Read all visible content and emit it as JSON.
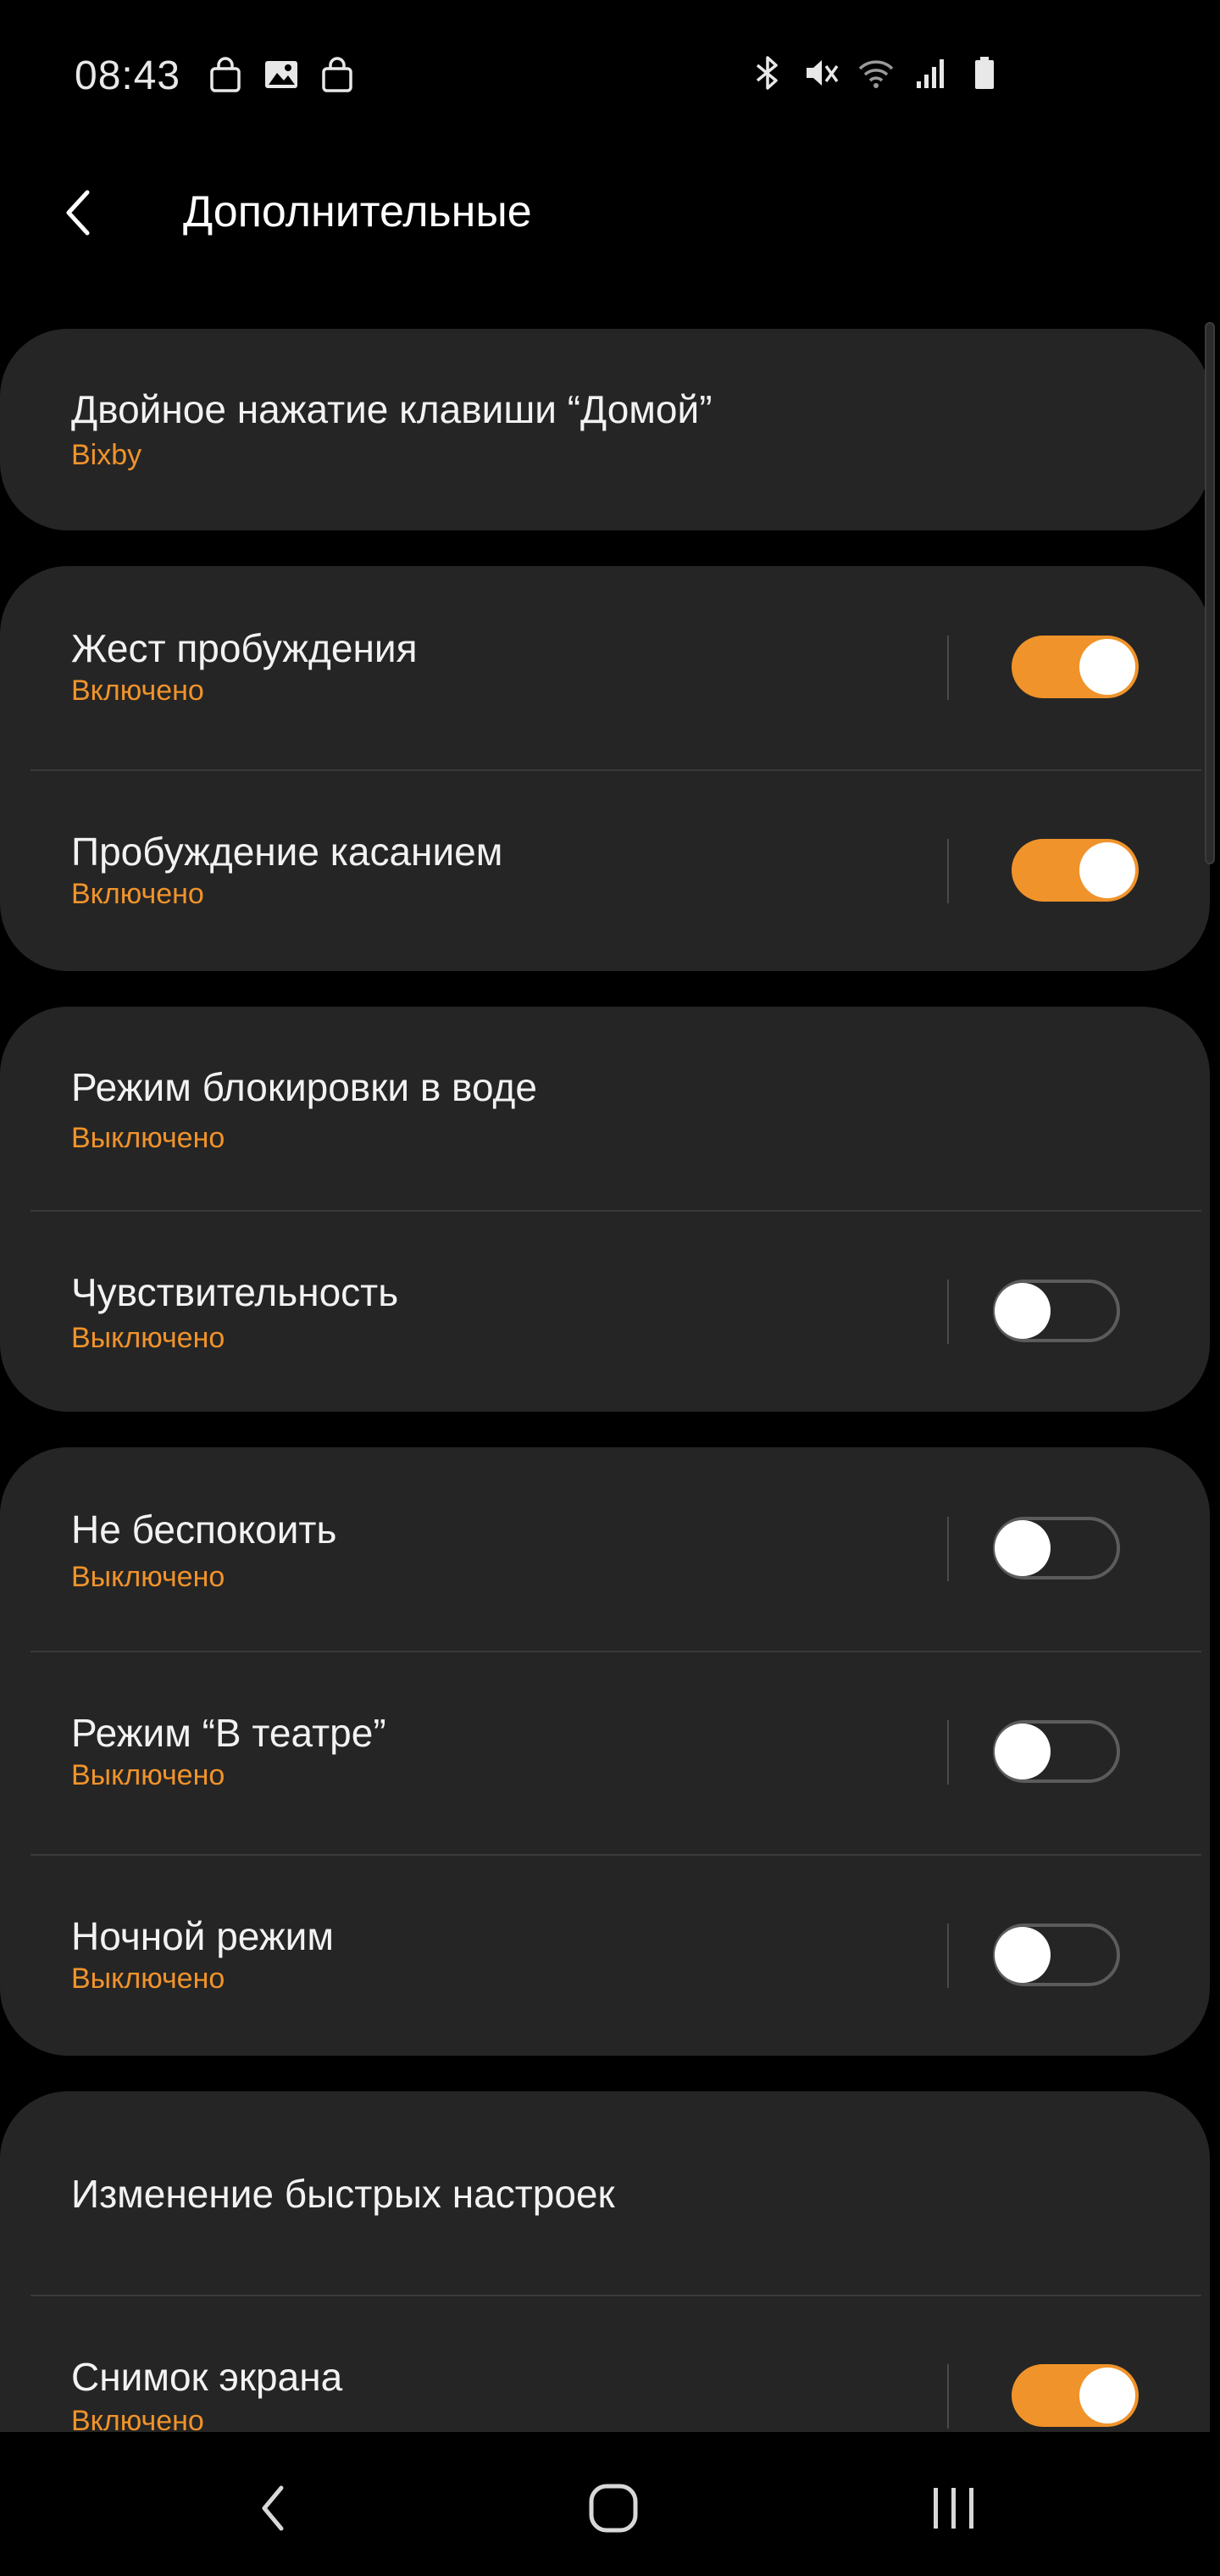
{
  "status_bar": {
    "time": "08:43",
    "left_icons": [
      "shopping-bag-icon",
      "gallery-icon",
      "shopping-bag-icon"
    ],
    "right_icons": [
      "bluetooth-icon",
      "mute-icon",
      "wifi-icon",
      "signal-icon",
      "battery-icon"
    ]
  },
  "header": {
    "back_icon": "back-arrow-icon",
    "title": "Дополнительные"
  },
  "accent_color": "#f0932b",
  "cards": [
    {
      "rows": [
        {
          "title": "Двойное нажатие клавиши “Домой”",
          "subtitle": "Bixby"
        }
      ]
    },
    {
      "rows": [
        {
          "title": "Жест пробуждения",
          "subtitle": "Включено",
          "toggle": "on"
        },
        {
          "title": "Пробуждение касанием",
          "subtitle": "Включено",
          "toggle": "on"
        }
      ]
    },
    {
      "rows": [
        {
          "title": "Режим блокировки в воде",
          "subtitle": "Выключено"
        },
        {
          "title": "Чувствительность",
          "subtitle": "Выключено",
          "toggle": "off"
        }
      ]
    },
    {
      "rows": [
        {
          "title": "Не беспокоить",
          "subtitle": "Выключено",
          "toggle": "off"
        },
        {
          "title": "Режим “В театре”",
          "subtitle": "Выключено",
          "toggle": "off"
        },
        {
          "title": "Ночной режим",
          "subtitle": "Выключено",
          "toggle": "off"
        }
      ]
    },
    {
      "rows": [
        {
          "title": "Изменение быстрых настроек"
        },
        {
          "title": "Снимок экрана",
          "subtitle": "Включено",
          "toggle": "on"
        }
      ]
    }
  ],
  "nav_bar": {
    "back_icon": "nav-back-icon",
    "home_icon": "nav-home-icon",
    "recents_icon": "nav-recents-icon"
  }
}
